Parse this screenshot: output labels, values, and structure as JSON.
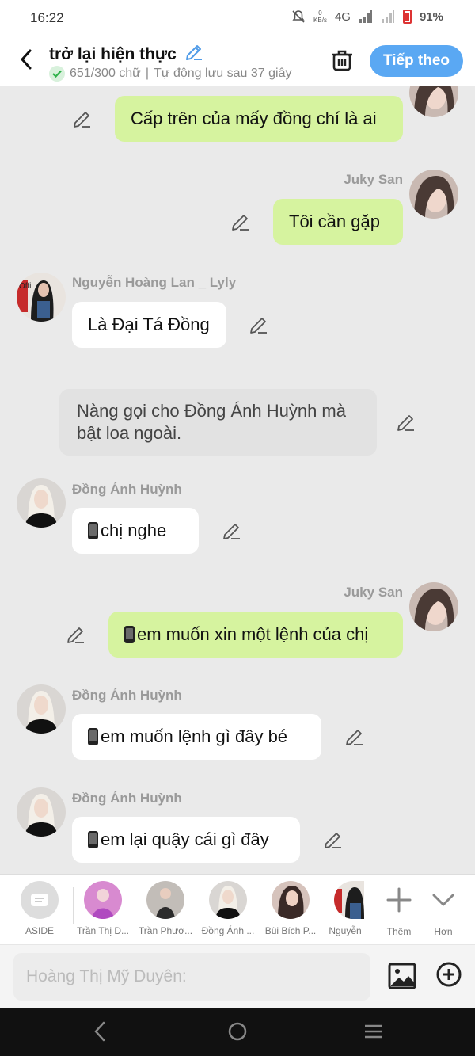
{
  "status": {
    "time": "16:22",
    "kbs_value": "0",
    "kbs_unit": "KB/s",
    "network": "4G",
    "battery": "91%"
  },
  "header": {
    "title": "trở lại hiện thực",
    "word_count": "651/300 chữ",
    "separator": "|",
    "autosave": "Tự động lưu sau 37 giây",
    "follow_label": "Tiếp theo"
  },
  "messages": [
    {
      "type": "me",
      "text": "Cấp trên của mấy đồng chí là ai"
    },
    {
      "type": "me",
      "sender": "Juky San",
      "text": "Tôi cần gặp"
    },
    {
      "type": "other",
      "sender": "Nguyễn Hoàng Lan _ Lyly",
      "text": "Là Đại Tá Đồng"
    },
    {
      "type": "narration",
      "text": "Nàng gọi cho Đồng Ánh Huỳnh mà bật loa ngoài."
    },
    {
      "type": "other",
      "sender": "Đồng Ánh Huỳnh",
      "text": "chị nghe"
    },
    {
      "type": "me",
      "sender": "Juky San",
      "text": "em muốn xin một lệnh của chị"
    },
    {
      "type": "other",
      "sender": "Đồng Ánh Huỳnh",
      "text": "em muốn lệnh gì đây bé"
    },
    {
      "type": "other",
      "sender": "Đồng Ánh Huỳnh",
      "text": "em lại quậy cái gì đây"
    }
  ],
  "characters": [
    {
      "name": "ASIDE"
    },
    {
      "name": "Trần Thị D..."
    },
    {
      "name": "Trần Phươ..."
    },
    {
      "name": "Đồng Ánh ..."
    },
    {
      "name": "Bùi Bích P..."
    },
    {
      "name": "Nguyễn"
    }
  ],
  "char_actions": {
    "more_label": "Thêm",
    "expand_label": "Hơn"
  },
  "input": {
    "placeholder": "Hoàng Thị Mỹ Duyên:"
  },
  "colors": {
    "accent": "#5aa8f3",
    "my_bubble": "#d6f39f",
    "other_bubble": "#ffffff",
    "narration_bubble": "#e2e2e2",
    "chat_bg": "#eaeaea"
  }
}
